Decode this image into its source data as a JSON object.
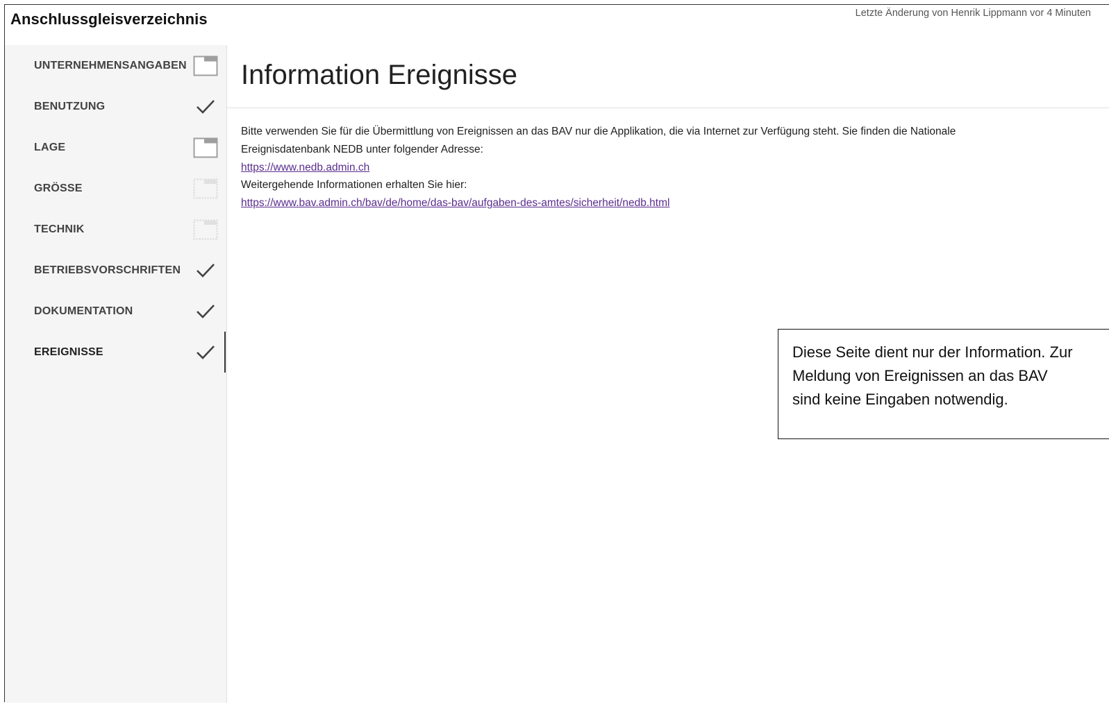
{
  "header": {
    "app_title": "Anschlussgleisverzeichnis",
    "last_change": "Letzte Änderung von Henrik Lippmann vor 4 Minuten"
  },
  "sidebar": {
    "items": [
      {
        "label": "UNTERNEHMENSANGABEN",
        "status_icon": "section-outline-icon",
        "active": false
      },
      {
        "label": "BENUTZUNG",
        "status_icon": "check-icon",
        "active": false
      },
      {
        "label": "LAGE",
        "status_icon": "section-outline-icon",
        "active": false
      },
      {
        "label": "GRÖSSE",
        "status_icon": "section-dotted-icon",
        "active": false
      },
      {
        "label": "TECHNIK",
        "status_icon": "section-dotted-icon",
        "active": false
      },
      {
        "label": "BETRIEBSVORSCHRIFTEN",
        "status_icon": "check-icon",
        "active": false
      },
      {
        "label": "DOKUMENTATION",
        "status_icon": "check-icon",
        "active": false
      },
      {
        "label": "EREIGNISSE",
        "status_icon": "check-icon",
        "active": true
      }
    ]
  },
  "main": {
    "title": "Information Ereignisse",
    "intro_line1": "Bitte verwenden Sie für die Übermittlung von Ereignissen an das BAV nur die Applikation, die via Internet zur Verfügung steht. Sie finden die Nationale",
    "intro_line2": "Ereignisdatenbank NEDB unter folgender Adresse:",
    "nedb_link": "https://www.nedb.admin.ch",
    "more_info": "Weitergehende Informationen erhalten Sie hier:",
    "bav_link": "https://www.bav.admin.ch/bav/de/home/das-bav/aufgaben-des-amtes/sicherheit/nedb.html"
  },
  "note": {
    "line1": "Diese Seite dient nur der Information. Zur",
    "line2": "Meldung von Ereignissen an das BAV",
    "line3": "sind keine Eingaben notwendig."
  },
  "colors": {
    "link": "#5b2d8e",
    "sidebar_bg": "#f5f5f5",
    "text": "#212121"
  }
}
